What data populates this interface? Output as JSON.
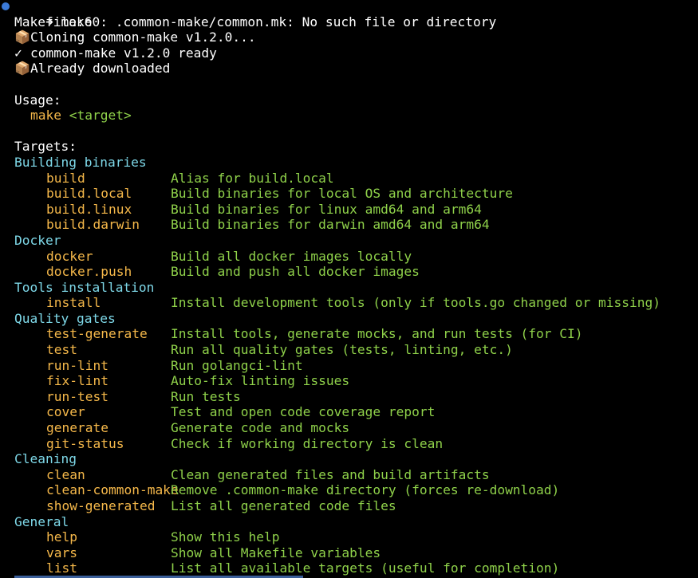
{
  "prompt": {
    "arrow": "➜",
    "command": "make"
  },
  "messages": [
    {
      "icon": "",
      "text": "Makefile:60: .common-make/common.mk: No such file or directory"
    },
    {
      "icon": "📦",
      "text": "Cloning common-make v1.2.0..."
    },
    {
      "icon": "✓",
      "text": "common-make v1.2.0 ready"
    },
    {
      "icon": "📦",
      "text": "Already downloaded"
    }
  ],
  "usage": {
    "heading": "Usage:",
    "command": "make",
    "arg": "<target>"
  },
  "targets_heading": "Targets:",
  "sections": [
    {
      "title": "Building binaries",
      "items": [
        {
          "name": "build",
          "desc": "Alias for build.local"
        },
        {
          "name": "build.local",
          "desc": "Build binaries for local OS and architecture"
        },
        {
          "name": "build.linux",
          "desc": "Build binaries for linux amd64 and arm64"
        },
        {
          "name": "build.darwin",
          "desc": "Build binaries for darwin amd64 and arm64"
        }
      ]
    },
    {
      "title": "Docker",
      "items": [
        {
          "name": "docker",
          "desc": "Build all docker images locally"
        },
        {
          "name": "docker.push",
          "desc": "Build and push all docker images"
        }
      ]
    },
    {
      "title": "Tools installation",
      "items": [
        {
          "name": "install",
          "desc": "Install development tools (only if tools.go changed or missing)"
        }
      ]
    },
    {
      "title": "Quality gates",
      "items": [
        {
          "name": "test-generate",
          "desc": "Install tools, generate mocks, and run tests (for CI)"
        },
        {
          "name": "test",
          "desc": "Run all quality gates (tests, linting, etc.)"
        },
        {
          "name": "run-lint",
          "desc": "Run golangci-lint"
        },
        {
          "name": "fix-lint",
          "desc": "Auto-fix linting issues"
        },
        {
          "name": "run-test",
          "desc": "Run tests"
        },
        {
          "name": "cover",
          "desc": "Test and open code coverage report"
        },
        {
          "name": "generate",
          "desc": "Generate code and mocks"
        },
        {
          "name": "git-status",
          "desc": "Check if working directory is clean"
        }
      ]
    },
    {
      "title": "Cleaning",
      "items": [
        {
          "name": "clean",
          "desc": "Clean generated files and build artifacts"
        },
        {
          "name": "clean-common-make",
          "desc": "Remove .common-make directory (forces re-download)"
        },
        {
          "name": "show-generated",
          "desc": "List all generated code files"
        }
      ]
    },
    {
      "title": "General",
      "items": [
        {
          "name": "help",
          "desc": "Show this help"
        },
        {
          "name": "vars",
          "desc": "Show all Makefile variables"
        },
        {
          "name": "list",
          "desc": "List all available targets (useful for completion)"
        }
      ]
    }
  ],
  "colors": {
    "background": "#000000",
    "text": "#ffffff",
    "target": "#f5b84a",
    "description": "#8fd14a",
    "section": "#7ed8e8",
    "prompt_dot": "#3b7ad8"
  }
}
